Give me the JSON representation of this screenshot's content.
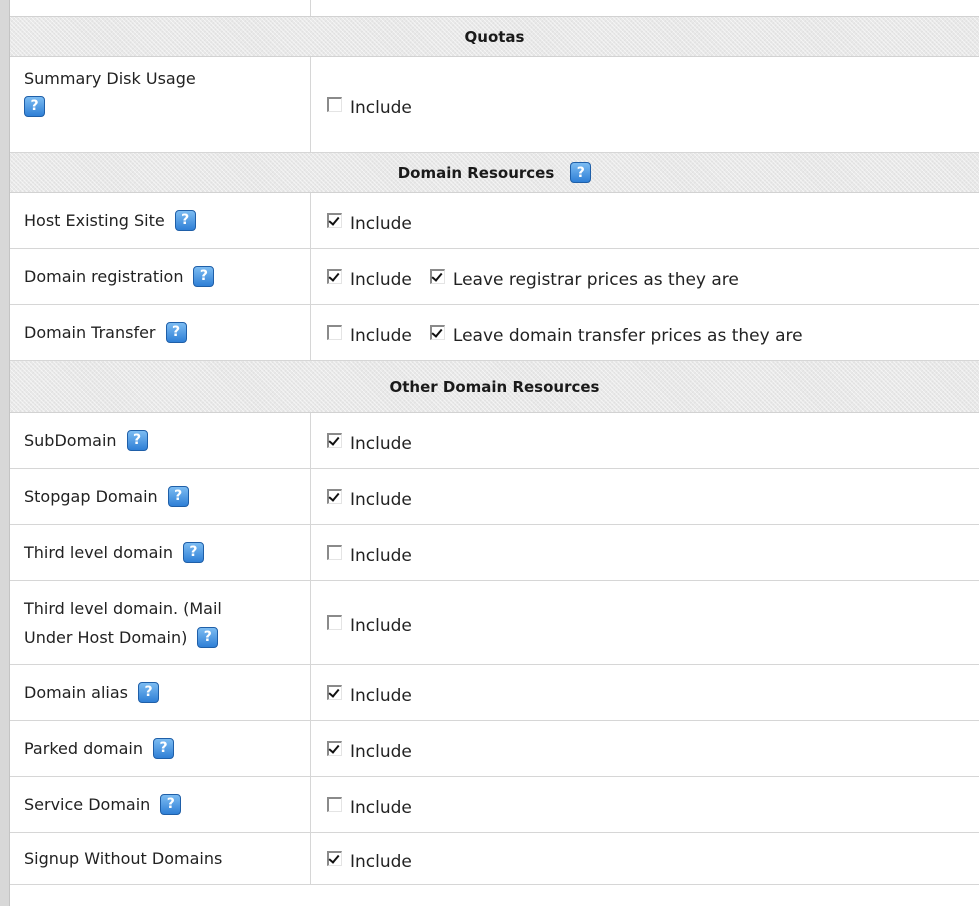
{
  "sections": {
    "quotas": {
      "title": "Quotas"
    },
    "domain_resources": {
      "title": "Domain Resources",
      "help_icon": "help-icon"
    },
    "other_domain_resources": {
      "title": "Other Domain Resources"
    }
  },
  "rows": {
    "summary_disk_usage": {
      "label": "Summary Disk Usage",
      "include_label": "Include",
      "include_checked": false
    },
    "host_existing_site": {
      "label": "Host Existing Site",
      "include_label": "Include",
      "include_checked": true
    },
    "domain_registration": {
      "label": "Domain registration",
      "include_label": "Include",
      "include_checked": true,
      "extra_label": "Leave registrar prices as they are",
      "extra_checked": true
    },
    "domain_transfer": {
      "label": "Domain Transfer",
      "include_label": "Include",
      "include_checked": false,
      "extra_label": "Leave domain transfer prices as they are",
      "extra_checked": true
    },
    "subdomain": {
      "label": "SubDomain",
      "include_label": "Include",
      "include_checked": true
    },
    "stopgap_domain": {
      "label": "Stopgap Domain",
      "include_label": "Include",
      "include_checked": true
    },
    "third_level_domain": {
      "label": "Third level domain",
      "include_label": "Include",
      "include_checked": false
    },
    "third_level_domain_mail": {
      "label_line1": "Third level domain. (Mail",
      "label_line2": "Under Host Domain)",
      "include_label": "Include",
      "include_checked": false
    },
    "domain_alias": {
      "label": "Domain alias",
      "include_label": "Include",
      "include_checked": true
    },
    "parked_domain": {
      "label": "Parked domain",
      "include_label": "Include",
      "include_checked": true
    },
    "service_domain": {
      "label": "Service Domain",
      "include_label": "Include",
      "include_checked": false
    },
    "signup_without_domains": {
      "label": "Signup Without Domains",
      "include_label": "Include",
      "include_checked": true
    }
  },
  "icons": {
    "help": "?"
  },
  "colors": {
    "help_icon_blue": "#2f7fd6",
    "section_bg": "#e8e8e8",
    "border": "#d2d2d2"
  }
}
